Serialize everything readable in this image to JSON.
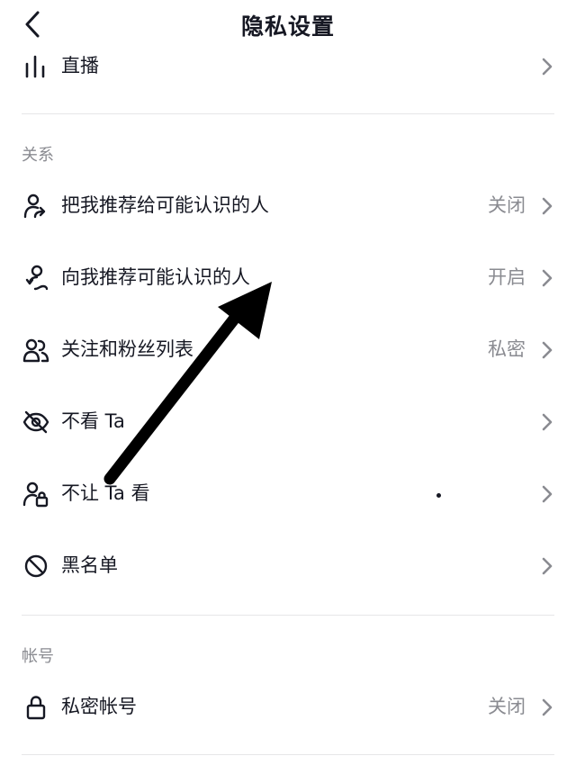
{
  "header": {
    "title": "隐私设置",
    "back_icon": "chevron-left-icon"
  },
  "rows_top": [
    {
      "label": "直播",
      "icon": "live-bars-icon",
      "value": ""
    }
  ],
  "sections": [
    {
      "title": "关系",
      "rows": [
        {
          "label": "把我推荐给可能认识的人",
          "icon": "user-share-icon",
          "value": "关闭"
        },
        {
          "label": "向我推荐可能认识的人",
          "icon": "user-link-icon",
          "value": "开启"
        },
        {
          "label": "关注和粉丝列表",
          "icon": "users-icon",
          "value": "私密"
        },
        {
          "label": "不看 Ta",
          "icon": "eye-off-icon",
          "value": ""
        },
        {
          "label": "不让 Ta 看",
          "icon": "user-lock-icon",
          "value": ""
        },
        {
          "label": "黑名单",
          "icon": "block-icon",
          "value": ""
        }
      ]
    },
    {
      "title": "帐号",
      "rows": [
        {
          "label": "私密帐号",
          "icon": "lock-icon",
          "value": "关闭"
        }
      ]
    }
  ],
  "colors": {
    "text": "#161823",
    "secondary": "#8a8b91",
    "divider": "#e6e6e8",
    "annotation": "#000000"
  }
}
